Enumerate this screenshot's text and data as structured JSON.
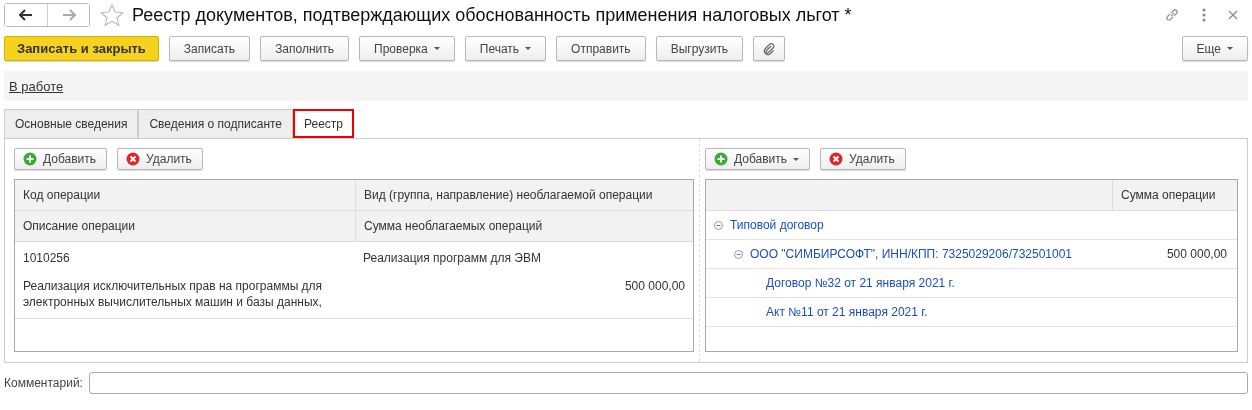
{
  "window": {
    "title": "Реестр документов, подтверждающих обоснованность применения налоговых льгот *"
  },
  "toolbar": [
    {
      "label": "Записать и закрыть",
      "kind": "primary"
    },
    {
      "label": "Записать",
      "kind": "plain"
    },
    {
      "label": "Заполнить",
      "kind": "plain"
    },
    {
      "label": "Проверка",
      "kind": "dropdown"
    },
    {
      "label": "Печать",
      "kind": "dropdown"
    },
    {
      "label": "Отправить",
      "kind": "plain"
    },
    {
      "label": "Выгрузить",
      "kind": "plain"
    },
    {
      "kind": "attach"
    }
  ],
  "more_button": "Еще",
  "status_link": "В работе",
  "tabs": [
    {
      "label": "Основные сведения",
      "selected": false
    },
    {
      "label": "Сведения о подписанте",
      "selected": false
    },
    {
      "label": "Реестр",
      "selected": true
    }
  ],
  "left_panel": {
    "buttons": [
      {
        "label": "Добавить",
        "kind": "add"
      },
      {
        "label": "Удалить",
        "kind": "delete"
      }
    ],
    "header_rows": [
      [
        "Код операции",
        "Вид (группа, направление) необлагаемой операции"
      ],
      [
        "Описание операции",
        "Сумма необлагаемых операций"
      ]
    ],
    "rows": [
      {
        "code": "1010256",
        "operation_type": "Реализация программ для ЭВМ",
        "description": "Реализация исключительных прав на программы для электронных вычислительных машин и базы данных,",
        "amount": "500 000,00"
      }
    ]
  },
  "right_panel": {
    "buttons": [
      {
        "label": "Добавить",
        "kind": "add-dropdown"
      },
      {
        "label": "Удалить",
        "kind": "delete"
      }
    ],
    "columns": [
      "Сумма операции"
    ],
    "tree": [
      {
        "label": "Типовой договор",
        "expanded": true,
        "children": [
          {
            "label": "ООО \"СИМБИРСОФТ\", ИНН/КПП: 7325029206/732501001",
            "amount": "500 000,00",
            "expanded": true,
            "children": [
              {
                "label": "Договор №32 от 21 января 2021 г."
              },
              {
                "label": "Акт №11 от 21 января 2021 г."
              }
            ]
          }
        ]
      }
    ]
  },
  "comment": {
    "label": "Комментарий:"
  }
}
